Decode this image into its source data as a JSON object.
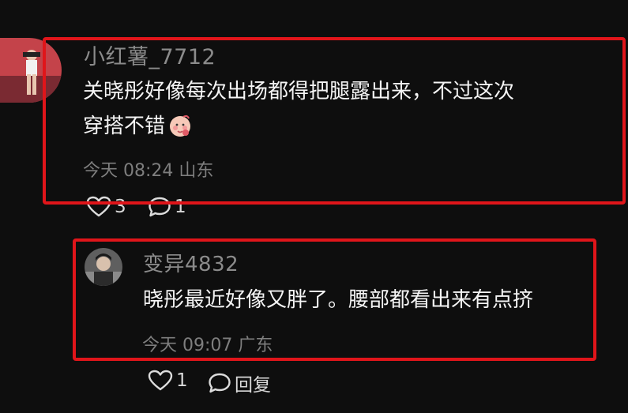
{
  "comment": {
    "username": "小红薯_7712",
    "text_line1": "关晓彤好像每次出场都得把腿露出来，不过这次",
    "text_line2": "穿搭不错",
    "timestamp": "今天 08:24",
    "location": "山东",
    "like_count": "3",
    "reply_count": "1"
  },
  "reply": {
    "username": "变异4832",
    "text": "晓彤最近好像又胖了。腰部都看出来有点挤",
    "timestamp": "今天 09:07",
    "location": "广东",
    "like_count": "1",
    "reply_label": "回复"
  },
  "icons": {
    "like": "heart-outline-icon",
    "comment": "speech-bubble-icon",
    "emoji": "baby-face-emoji"
  },
  "colors": {
    "background": "#0e0e0e",
    "highlight": "#e0151a",
    "meta_text": "#7e7e7e"
  }
}
